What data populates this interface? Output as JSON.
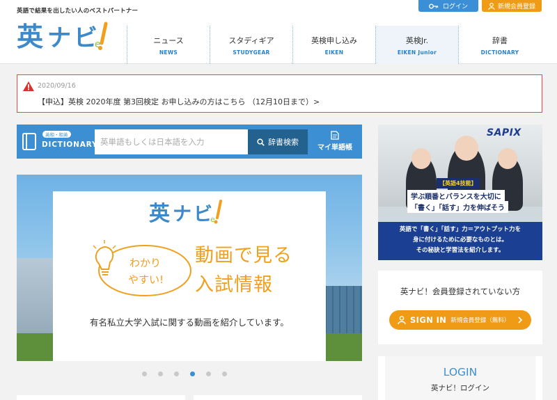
{
  "header": {
    "tagline": "英語で結果を出したい人のベストパートナー",
    "logo_text": "英ナビ!",
    "login_label": "ログイン",
    "register_label": "新規会員登録",
    "nav": [
      {
        "jp": "ニュース",
        "en": "NEWS"
      },
      {
        "jp": "スタディギア",
        "en": "STUDYGEAR"
      },
      {
        "jp": "英検申し込み",
        "en": "EIKEN"
      },
      {
        "jp": "英検Jr.",
        "en": "EIKEN Junior"
      },
      {
        "jp": "辞書",
        "en": "DICTIONARY"
      }
    ]
  },
  "notice": {
    "date": "2020/09/16",
    "message": "【申込】英検 2020年度 第3回検定 お申し込みの方はこちら （12月10日まで）>"
  },
  "dictionary": {
    "tag": "英和・和英",
    "brand": "DICTIONARY",
    "placeholder": "英単語もしくは日本語を入力",
    "search_label": "辞書検索",
    "mylist_label": "マイ単語帳"
  },
  "banner": {
    "logo_text": "英ナビ!",
    "bubble_line1": "わかり",
    "bubble_line2": "やすい!",
    "headline1": "動画で見る",
    "headline2": "入試情報",
    "subtitle": "有名私立大学入試に関する動画を紹介しています。",
    "slide_count": 6,
    "active_slide": 4
  },
  "ad": {
    "brand": "SAPIX",
    "tag": "【英語4技能】",
    "line1": "学ぶ順番とバランスを大切に",
    "line2": "「書く」「話す」力を伸ばそう",
    "bottom": [
      "英語で「書く」「話す」力＝アウトプット力を",
      "身に付けるために必要なものとは。",
      "その秘訣と学習法を紹介します。"
    ]
  },
  "member": {
    "title": "英ナビ！会員登録されていない方",
    "signin_label": "SIGN IN",
    "signin_sub": "新規会員登録（無料）"
  },
  "login": {
    "heading": "LOGIN",
    "sub": "英ナビ！ログイン"
  },
  "colors": {
    "primary_blue": "#3b8fd2",
    "orange": "#f09b16",
    "alert_red": "#e24a4a"
  }
}
